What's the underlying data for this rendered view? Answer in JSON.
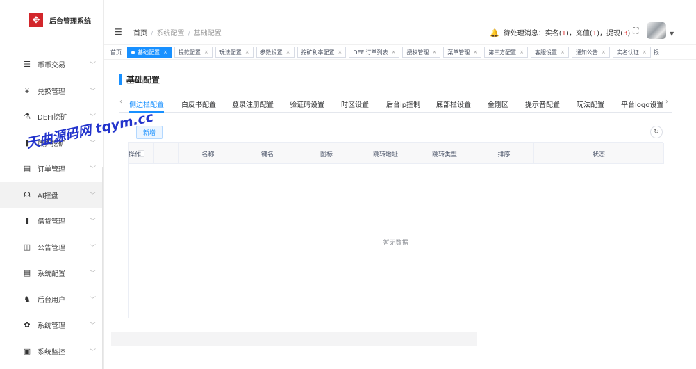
{
  "app": {
    "logo_glyph": "✥",
    "title": "后台管理系统"
  },
  "sidebar": {
    "items": [
      {
        "icon": "☰",
        "icon_name": "list-icon",
        "label": "币币交易"
      },
      {
        "icon": "¥",
        "icon_name": "yen-icon",
        "label": "兑换管理"
      },
      {
        "icon": "⚗",
        "icon_name": "mining-icon",
        "label": "DEFI挖矿"
      },
      {
        "icon": "▮",
        "icon_name": "bar-chart-icon",
        "label": "质押挖矿"
      },
      {
        "icon": "▤",
        "icon_name": "document-icon",
        "label": "订单管理"
      },
      {
        "icon": "☊",
        "icon_name": "ai-icon",
        "label": "AI控盘"
      },
      {
        "icon": "▮",
        "icon_name": "wallet-icon",
        "label": "借贷管理"
      },
      {
        "icon": "◫",
        "icon_name": "announcement-icon",
        "label": "公告管理"
      },
      {
        "icon": "▤",
        "icon_name": "config-icon",
        "label": "系统配置"
      },
      {
        "icon": "♞",
        "icon_name": "users-icon",
        "label": "后台用户"
      },
      {
        "icon": "✿",
        "icon_name": "gear-icon",
        "label": "系统管理"
      },
      {
        "icon": "▣",
        "icon_name": "monitor-icon",
        "label": "系统监控"
      }
    ],
    "chevron": "﹀",
    "active_index": 5
  },
  "watermark": "天曲源码网 tqym.cc",
  "header": {
    "fold_icon": "☰",
    "breadcrumb": [
      "首页",
      "系统配置",
      "基础配置"
    ],
    "breadcrumb_sep": "/",
    "notice": {
      "bell": "🔔",
      "prefix": "待处理消息：实名(",
      "realname_count": "1",
      "mid1": ")，充值(",
      "recharge_count": "1",
      "mid2": ")，提现(",
      "withdraw_count": "3",
      "suffix": ")"
    },
    "fullscreen_icon": "⛶",
    "avatar_caret": "▼"
  },
  "tags": [
    {
      "label": "首页",
      "closable": false,
      "active": false
    },
    {
      "label": "基础配置",
      "closable": true,
      "active": true
    },
    {
      "label": "提款配置",
      "closable": true,
      "active": false
    },
    {
      "label": "玩法配置",
      "closable": true,
      "active": false
    },
    {
      "label": "参数设置",
      "closable": true,
      "active": false
    },
    {
      "label": "挖矿利率配置",
      "closable": true,
      "active": false
    },
    {
      "label": "DEFI订单列表",
      "closable": true,
      "active": false
    },
    {
      "label": "授权管理",
      "closable": true,
      "active": false
    },
    {
      "label": "菜单管理",
      "closable": true,
      "active": false
    },
    {
      "label": "第三方配置",
      "closable": true,
      "active": false
    },
    {
      "label": "客服设置",
      "closable": true,
      "active": false
    },
    {
      "label": "通知公告",
      "closable": true,
      "active": false
    },
    {
      "label": "实名认证",
      "closable": true,
      "active": false
    },
    {
      "label": "银",
      "closable": false,
      "active": false
    }
  ],
  "tag_close": "×",
  "page_title": "基础配置",
  "subtabs": {
    "left_arrow": "‹",
    "right_arrow": "›",
    "items": [
      "侧边栏配置",
      "白皮书配置",
      "登录注册配置",
      "验证码设置",
      "时区设置",
      "后台ip控制",
      "底部栏设置",
      "金刚区",
      "提示音配置",
      "玩法配置",
      "平台logo设置"
    ]
  },
  "toolbar": {
    "add_label": "新增",
    "refresh_icon": "↻"
  },
  "table": {
    "columns": [
      "名称",
      "键名",
      "图标",
      "跳转地址",
      "跳转类型",
      "排序",
      "状态",
      "操作"
    ],
    "empty_text": "暂无数据"
  }
}
